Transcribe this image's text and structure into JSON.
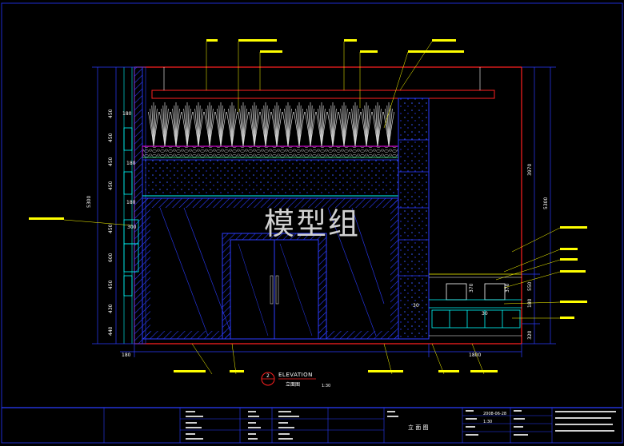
{
  "watermark": "模型组",
  "view": {
    "number": "2",
    "code": "ELEVATION",
    "title": "立面图",
    "scale": "1:30"
  },
  "dimensions": {
    "left_overall": "5300",
    "right_overall": "5300",
    "left_segments": [
      "450",
      "450",
      "450",
      "450",
      "450",
      "600",
      "450",
      "430",
      "440"
    ],
    "left_small": [
      "180",
      "180",
      "180",
      "300"
    ],
    "right_upper": "3970",
    "right_segments": [
      "550",
      "180",
      "320"
    ],
    "bottom_left": "180",
    "bottom_right": "1800",
    "inner_small": [
      "370",
      "370",
      "30",
      "30"
    ]
  },
  "title_block": {
    "cells": [
      "2008-06-28",
      "1:30",
      "立 面 图"
    ]
  },
  "colors": {
    "background": "#000000",
    "cyan": "#00ffff",
    "blue": "#2b3cff",
    "red": "#ff2020",
    "white": "#ffffff",
    "magenta": "#ff00ff",
    "yellow": "#ffff00",
    "green": "#00ff66"
  }
}
